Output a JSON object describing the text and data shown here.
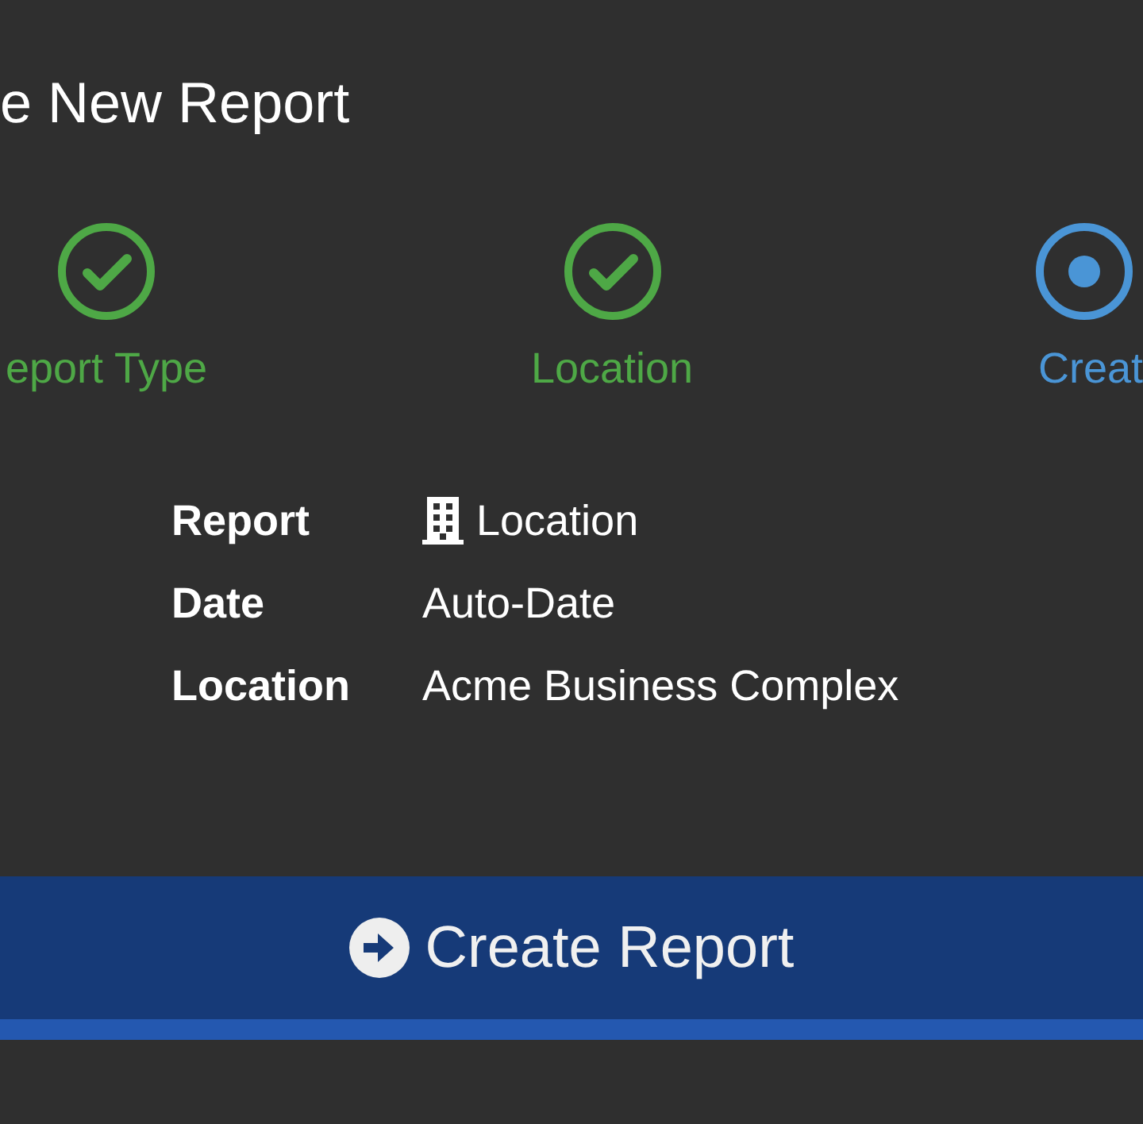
{
  "title": "e New Report",
  "steps": [
    {
      "label": "eport Type",
      "completed": true,
      "selected": false
    },
    {
      "label": "Location",
      "completed": true,
      "selected": false
    },
    {
      "label": "Creat",
      "completed": false,
      "selected": true
    }
  ],
  "summary": [
    {
      "label": "Report",
      "value": "Location",
      "kind": "with_icon"
    },
    {
      "label": "Date",
      "value": "Auto-Date",
      "kind": "plain"
    },
    {
      "label": "Location",
      "value": "Acme Business Complex",
      "kind": "plain"
    }
  ],
  "button": {
    "label": "Create Report"
  }
}
